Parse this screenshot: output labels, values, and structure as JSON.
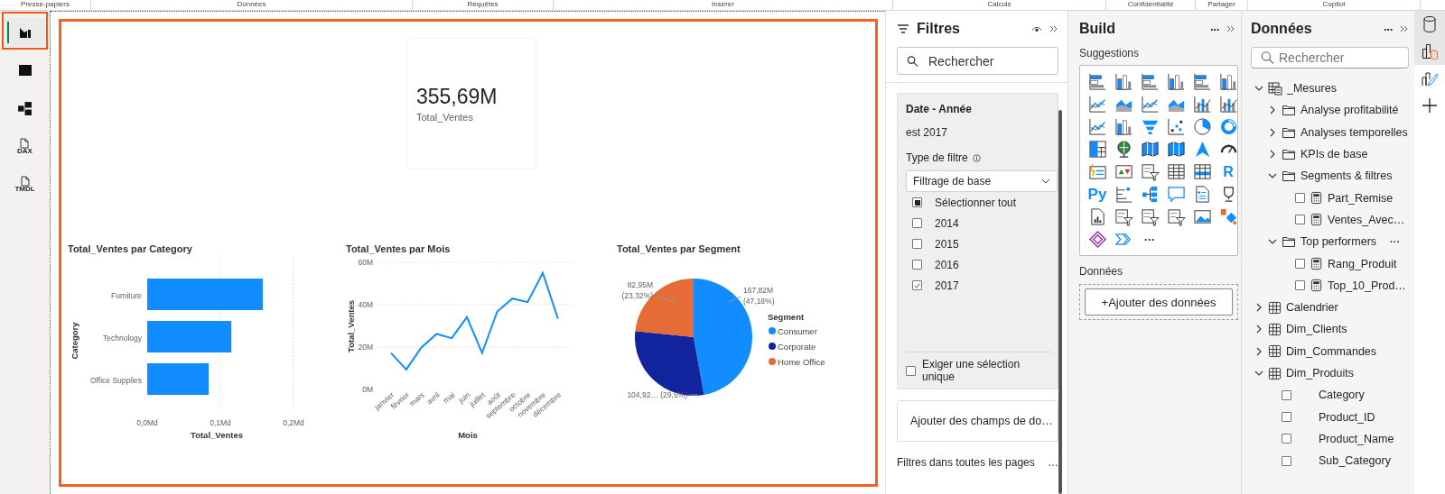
{
  "ribbon": {
    "groups": [
      "Presse-papiers",
      "Données",
      "Requêtes",
      "Insérer",
      "Calculs",
      "Confidentialité",
      "Partager",
      "Copilot"
    ]
  },
  "view_rail": {
    "items": [
      {
        "kind": "report",
        "selected": true
      },
      {
        "kind": "table",
        "selected": false
      },
      {
        "kind": "model",
        "selected": false
      },
      {
        "kind": "dax",
        "label": "DAX",
        "selected": false
      },
      {
        "kind": "tmdl",
        "label": "TMDL",
        "selected": false
      }
    ]
  },
  "kpi_card": {
    "value": "355,69M",
    "label": "Total_Ventes"
  },
  "charts": [
    {
      "chart_data": {
        "type": "bar",
        "orientation": "horizontal",
        "title": "Total_Ventes par Category",
        "xlabel": "Total_Ventes",
        "ylabel": "Category",
        "categories": [
          "Furniture",
          "Technology",
          "Office Supplies"
        ],
        "series": [
          {
            "color": "#118dff",
            "values": [
              0.158,
              0.115,
              0.084
            ]
          }
        ],
        "xlim": [
          0,
          0.2
        ],
        "xticks": [
          {
            "value": 0,
            "label": "0,0Md"
          },
          {
            "value": 0.1,
            "label": "0,1Md"
          },
          {
            "value": 0.2,
            "label": "0,2Md"
          }
        ]
      }
    },
    {
      "chart_data": {
        "type": "line",
        "title": "Total_Ventes par Mois",
        "xlabel": "Mois",
        "ylabel": "Total_Ventes",
        "categories": [
          "janvier",
          "février",
          "mars",
          "avril",
          "mai",
          "juin",
          "juillet",
          "août",
          "septembre",
          "octobre",
          "novembre",
          "décembre"
        ],
        "series": [
          {
            "color": "#118dff",
            "values": [
              17.2,
              9.4,
              19.8,
              26.2,
              24.2,
              34.1,
              17.2,
              36.8,
              42.9,
              41.2,
              55.0,
              33.4
            ]
          }
        ],
        "ylim": [
          0,
          60
        ],
        "yticks": [
          {
            "value": 0,
            "label": "0M"
          },
          {
            "value": 20,
            "label": "20M"
          },
          {
            "value": 40,
            "label": "40M"
          },
          {
            "value": 60,
            "label": "60M"
          }
        ]
      }
    },
    {
      "chart_data": {
        "type": "pie",
        "title": "Total_Ventes par Segment",
        "categories": [
          "Consumer",
          "Corporate",
          "Home Office"
        ],
        "series": [
          {
            "values": [
              47.18,
              29.5,
              23.32
            ]
          }
        ],
        "value_labels": [
          [
            "167,82M",
            "(47,18%)"
          ],
          [
            "104,92… (29,5%)"
          ],
          [
            "82,95M",
            "(23,32%)"
          ]
        ],
        "legend": {
          "title": "Segment",
          "items": [
            {
              "color": "#118dff"
            },
            {
              "color": "#12239e"
            },
            {
              "color": "#e66c37"
            }
          ]
        }
      }
    }
  ],
  "filters": {
    "title": "Filtres",
    "search_placeholder": "Rechercher",
    "card": {
      "title": "Date - Année",
      "summary": "est 2017",
      "type_label": "Type de filtre",
      "type_value": "Filtrage de base",
      "select_all": {
        "label": "Sélectionner tout",
        "partial": true
      },
      "options": [
        {
          "label": "2014",
          "checked": false
        },
        {
          "label": "2015",
          "checked": false
        },
        {
          "label": "2016",
          "checked": false
        },
        {
          "label": "2017",
          "checked": true
        }
      ],
      "single_select": {
        "label": "Exiger une sélection unique",
        "checked": false
      }
    },
    "drop_zone": "Ajouter des champs de do…",
    "all_pages": "Filtres dans toutes les pages",
    "all_pages_more": "…"
  },
  "build": {
    "title": "Build",
    "more": "···",
    "suggestions_label": "Suggestions",
    "text_visuals": [
      "R",
      "Py"
    ],
    "more_visuals": "···",
    "data_label": "Données",
    "add_data_button": "+Ajouter des données"
  },
  "fields": {
    "title": "Données",
    "more": "···",
    "search_placeholder": "Rechercher",
    "tree": [
      {
        "kind": "measure-table",
        "label": "_Mesures",
        "expanded": true,
        "children": [
          {
            "kind": "folder",
            "label": "Analyse profitabilité",
            "expanded": false
          },
          {
            "kind": "folder",
            "label": "Analyses temporelles",
            "expanded": false
          },
          {
            "kind": "folder",
            "label": "KPIs de base",
            "expanded": false
          },
          {
            "kind": "folder",
            "label": "Segments & filtres",
            "expanded": true,
            "children": [
              {
                "kind": "measure",
                "label": "Part_Remise",
                "checked": false
              },
              {
                "kind": "measure",
                "label": "Ventes_Avec…",
                "checked": false
              }
            ]
          },
          {
            "kind": "folder",
            "label": "Top performers",
            "expanded": true,
            "more": "···",
            "children": [
              {
                "kind": "measure",
                "label": "Rang_Produit",
                "checked": false
              },
              {
                "kind": "measure",
                "label": "Top_10_Prod…",
                "checked": false
              }
            ]
          }
        ]
      },
      {
        "kind": "table",
        "label": "Calendrier",
        "expanded": false
      },
      {
        "kind": "table",
        "label": "Dim_Clients",
        "expanded": false
      },
      {
        "kind": "table",
        "label": "Dim_Commandes",
        "expanded": false
      },
      {
        "kind": "table",
        "label": "Dim_Produits",
        "expanded": true,
        "children": [
          {
            "kind": "field",
            "label": "Category",
            "checked": false
          },
          {
            "kind": "field",
            "label": "Product_ID",
            "checked": false
          },
          {
            "kind": "field",
            "label": "Product_Name",
            "checked": false
          },
          {
            "kind": "field",
            "label": "Sub_Category",
            "checked": false
          }
        ]
      }
    ]
  },
  "right_rail": {
    "items": [
      {
        "kind": "data",
        "selected": true
      },
      {
        "kind": "build",
        "selected": true
      },
      {
        "kind": "format",
        "selected": false
      },
      {
        "kind": "add",
        "selected": false
      }
    ]
  }
}
